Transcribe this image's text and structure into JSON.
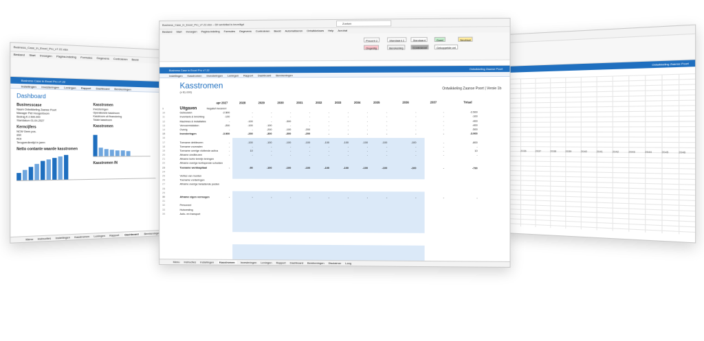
{
  "left_window": {
    "title": "Business_Case_in_Excel_Pro_v7.22.xlsx",
    "ribbon_tabs": [
      "Bestand",
      "Start",
      "Invoegen",
      "Pagina-indeling",
      "Formules",
      "Gegevens",
      "Controleren",
      "Beeld"
    ],
    "app_bar": "Business Case in Excel Pro v7.22",
    "nav": [
      "Instellingen",
      "Investeringen",
      "Leningen",
      "Rapport",
      "Dashboard",
      "Berekeningen"
    ],
    "page_title": "Dashboard",
    "section_businesscase": "Businesscase",
    "rows_business": [
      "Naam   Ontwikkeling Zaanse Poort",
      "Manager   Piet Hoogenboom",
      "Bedrag   € 2.500.000",
      "Startdatum   01-04-2027"
    ],
    "section_kengetallen": "Kerncijfers",
    "rows_kengetallen": [
      "NCW          Geen pos.",
      "IRR",
      "ROI",
      "Terugverdientijd in jaren"
    ],
    "section_chart": "Netto contante waarde kasstromen",
    "col2_title": "Kasstromen",
    "col2_rows": [
      "Investeringen",
      "Operationele kasstroom",
      "Kasstroom uit financiering",
      "Totale kasstroom"
    ],
    "col2_chart": "Kasstromen",
    "col2_in": "Kasstromen IN",
    "sheettabs": [
      "Menu",
      "Instructies",
      "Instellingen",
      "Kasstromen",
      "Leningen",
      "Rapport",
      "Dashboard",
      "Berekeningen"
    ],
    "active_tab": "Dashboard"
  },
  "right_window": {
    "app_bar": "Ontwikkeling Zaanse Poort",
    "years": [
      "2036",
      "2037",
      "2038",
      "2039",
      "2040",
      "2041",
      "2042",
      "2043",
      "2044",
      "2045",
      "2046"
    ]
  },
  "center_window": {
    "title": "Business_Case_in_Excel_Pro_v7.22.xlsx – Dit werkblad is beveiligd",
    "search": "Zoeken",
    "ribbon_tabs": [
      "Bestand",
      "Start",
      "Invoegen",
      "Pagina-indeling",
      "Formules",
      "Gegevens",
      "Controleren",
      "Beeld",
      "Automatiseren",
      "Ontwikkelaars",
      "Help",
      "Acrobat"
    ],
    "styles": [
      "Procent 2",
      "Standaard 2",
      "Standaard",
      "Goed",
      "Neutraal",
      "Ongeldig",
      "Berekening",
      "Controlecel",
      "Gekoppelde cel"
    ],
    "app_bar": "Business Case in Excel Pro v7.22",
    "app_bar_right": "Ontwikkeling Zaanse Poort",
    "nav": [
      "Instellingen",
      "Kasstromen",
      "Investeringen",
      "Leningen",
      "Rapport",
      "Dashboard",
      "Berekeningen"
    ],
    "sheet_title": "Kasstromen",
    "unit": "(x €1.000)",
    "company": "Ontwikkeling Zaanse Poort | Versie 1b",
    "years": [
      "apr 2027",
      "2028",
      "2029",
      "2030",
      "2031",
      "2032",
      "2033",
      "2034",
      "2035",
      "2036",
      "2037",
      "Totaal"
    ],
    "rows": [
      {
        "n": "9",
        "label": "Uitgaven",
        "note": "Negatief invoeren!",
        "type": "hdr",
        "vals": []
      },
      {
        "n": "10",
        "label": "Gebouwen",
        "vals": [
          "-2.500",
          "-",
          "-",
          "-",
          "-",
          "-",
          "-",
          "-",
          "-",
          "-",
          "-",
          "-2.500"
        ]
      },
      {
        "n": "11",
        "label": "Inventaris & Inrichting",
        "vals": [
          "-100",
          "-",
          "-",
          "-",
          "-",
          "-",
          "-",
          "-",
          "-",
          "-",
          "-",
          "-100"
        ]
      },
      {
        "n": "12",
        "label": "Machines & Installaties",
        "vals": [
          "-",
          "-100",
          "-",
          "-300",
          "-",
          "-",
          "-",
          "-",
          "-",
          "-",
          "-",
          "-400"
        ]
      },
      {
        "n": "13",
        "label": "Vervoermiddelen",
        "vals": [
          "-200",
          "-100",
          "-100",
          "-",
          "-",
          "-",
          "-",
          "-",
          "-",
          "-",
          "-",
          "-400"
        ]
      },
      {
        "n": "14",
        "label": "Overig",
        "vals": [
          "-",
          "-",
          "-200",
          "-100",
          "-200",
          "-",
          "-",
          "-",
          "-",
          "-",
          "-",
          "-500"
        ]
      },
      {
        "n": "15",
        "label": "Investeringen",
        "type": "bold",
        "vals": [
          "-3.000",
          "-200",
          "-300",
          "-300",
          "-200",
          "-",
          "-",
          "-",
          "-",
          "-",
          "-",
          "-3.900"
        ]
      },
      {
        "n": "16",
        "label": "",
        "vals": []
      },
      {
        "n": "17",
        "label": "Toename debiteuren",
        "vals": [
          "-",
          "-100",
          "-100",
          "-100",
          "-100",
          "-100",
          "-100",
          "-100",
          "-100",
          "-100",
          "-",
          "-800"
        ]
      },
      {
        "n": "18",
        "label": "Toename voorraden",
        "vals": [
          "-",
          "-",
          "-",
          "-",
          "-",
          "-",
          "-",
          "-",
          "-",
          "-",
          "-",
          "-"
        ]
      },
      {
        "n": "19",
        "label": "Toename overige vlottende activa",
        "vals": [
          "-",
          "10",
          "-",
          "-",
          "-",
          "-",
          "-",
          "-",
          "-",
          "-",
          "-",
          "10"
        ]
      },
      {
        "n": "20",
        "label": "Afname crediteuren",
        "vals": [
          "-",
          "-",
          "-",
          "-",
          "-",
          "-",
          "-",
          "-",
          "-",
          "-",
          "-",
          "-"
        ]
      },
      {
        "n": "21",
        "label": "Afname korte termijn leningen",
        "vals": []
      },
      {
        "n": "22",
        "label": "Afname overige kortlopende schulden",
        "vals": []
      },
      {
        "n": "23",
        "label": "Toename werkkapitaal",
        "type": "bold",
        "vals": [
          "-",
          "-90",
          "-100",
          "-100",
          "-100",
          "-100",
          "-100",
          "-100",
          "-100",
          "-100",
          "-",
          "-790"
        ]
      },
      {
        "n": "24",
        "label": "",
        "vals": []
      },
      {
        "n": "25",
        "label": "Verlies van munten",
        "vals": []
      },
      {
        "n": "26",
        "label": "Toename vorderingen",
        "vals": []
      },
      {
        "n": "27",
        "label": "Afname overige belastende posten",
        "vals": []
      },
      {
        "n": "28",
        "label": "",
        "vals": []
      },
      {
        "n": "29",
        "label": "",
        "vals": []
      },
      {
        "n": "30",
        "label": "Afname eigen vermogen",
        "type": "bold",
        "vals": [
          "-",
          "-",
          "-",
          "-",
          "-",
          "-",
          "-",
          "-",
          "-",
          "-",
          "-",
          "-"
        ]
      },
      {
        "n": "31",
        "label": "",
        "vals": []
      },
      {
        "n": "32",
        "label": "Personeel",
        "vals": []
      },
      {
        "n": "33",
        "label": "Huisvesting",
        "vals": []
      },
      {
        "n": "34",
        "label": "Auto- en transport",
        "vals": []
      }
    ],
    "sheettabs": [
      "Menu",
      "Instructies",
      "Instellingen",
      "Kasstromen",
      "Investeringen",
      "Leningen",
      "Rapport",
      "Dashboard",
      "Berekeningen",
      "Disclaimer",
      "Leeg"
    ],
    "active_tab": "Kasstromen"
  }
}
